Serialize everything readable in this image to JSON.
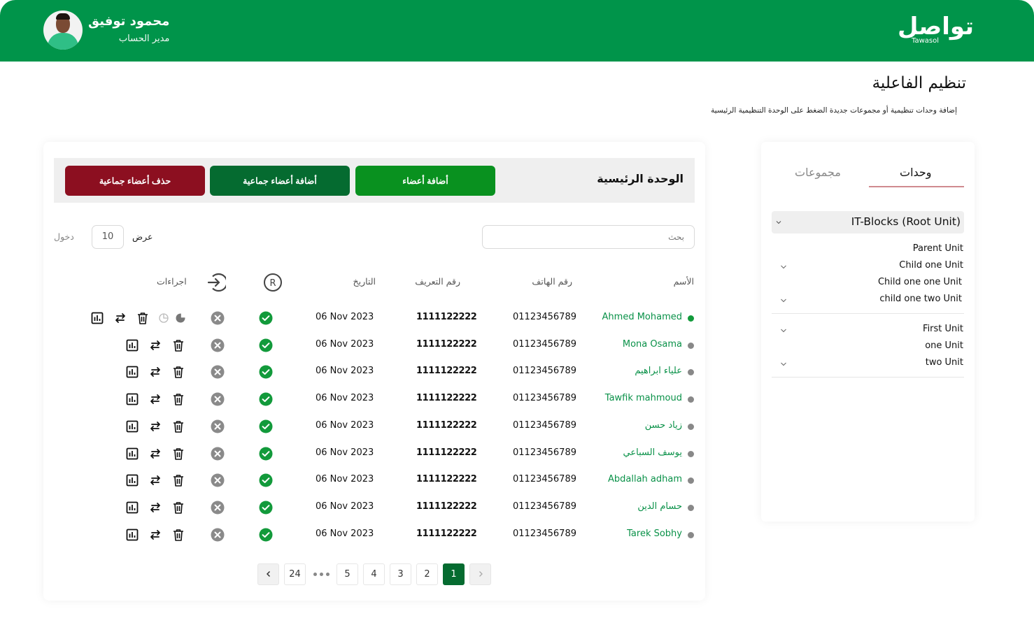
{
  "header": {
    "user_name": "محمود توفيق",
    "user_role": "مدير الحساب",
    "logo_ar": "تواصل",
    "logo_en": "Tawasol",
    "brand_color": "#00944a"
  },
  "page": {
    "title": "تنظيم الفاعلية",
    "subtitle": "إضافة وحدات تنظيمية أو مجموعات جديدة الضغط على الوحدة التنظيمية الرئيسية"
  },
  "toolbar": {
    "unit_title": "الوحدة الرئيسية",
    "add_members": "أضافة أعضاء",
    "bulk_add": "أضافة أعضاء جماعية",
    "bulk_delete": "حذف أعضاء جماعية"
  },
  "filters": {
    "search_placeholder": "بحث",
    "show_label": "عرض",
    "page_size": "10",
    "entries_label": "دخول"
  },
  "table": {
    "headers": {
      "name": "الأسم",
      "phone": "رقم الهاتف",
      "id": "رقم التعريف",
      "date": "التاريخ",
      "registered_icon": "registered-icon",
      "login_icon": "login-icon",
      "actions": "اجراءات"
    },
    "rows": [
      {
        "name": "Ahmed Mohamed",
        "phone": "01123456789",
        "id": "1111122222",
        "date": "06 Nov 2023",
        "status": "active"
      },
      {
        "name": "Mona Osama",
        "phone": "01123456789",
        "id": "1111122222",
        "date": "06 Nov 2023",
        "status": "inactive"
      },
      {
        "name": "علياء ابراهيم",
        "phone": "01123456789",
        "id": "1111122222",
        "date": "06 Nov 2023",
        "status": "inactive"
      },
      {
        "name": "Tawfik mahmoud",
        "phone": "01123456789",
        "id": "1111122222",
        "date": "06 Nov 2023",
        "status": "inactive"
      },
      {
        "name": "زياد حسن",
        "phone": "01123456789",
        "id": "1111122222",
        "date": "06 Nov 2023",
        "status": "inactive"
      },
      {
        "name": "يوسف السباعي",
        "phone": "01123456789",
        "id": "1111122222",
        "date": "06 Nov 2023",
        "status": "inactive"
      },
      {
        "name": "Abdallah adham",
        "phone": "01123456789",
        "id": "1111122222",
        "date": "06 Nov 2023",
        "status": "inactive"
      },
      {
        "name": "حسام الدين",
        "phone": "01123456789",
        "id": "1111122222",
        "date": "06 Nov 2023",
        "status": "inactive"
      },
      {
        "name": "Tarek Sobhy",
        "phone": "01123456789",
        "id": "1111122222",
        "date": "06 Nov 2023",
        "status": "inactive"
      }
    ]
  },
  "pagination": {
    "pages": [
      "1",
      "2",
      "3",
      "4",
      "5"
    ],
    "last": "24",
    "current": "1"
  },
  "side": {
    "tabs": [
      {
        "label": "وحدات",
        "active": true
      },
      {
        "label": "مجموعات",
        "active": false
      }
    ],
    "root_unit": "IT-Blocks (Root Unit)",
    "tree": [
      {
        "label": "Parent Unit",
        "chevron": false
      },
      {
        "label": "Child one Unit",
        "chevron": true
      },
      {
        "label": "Child one one Unit",
        "chevron": false
      },
      {
        "label": "child one two Unit",
        "chevron": true
      },
      {
        "label": "First Unit",
        "chevron": true
      },
      {
        "label": "one Unit",
        "chevron": false
      },
      {
        "label": "two Unit",
        "chevron": true
      }
    ]
  }
}
